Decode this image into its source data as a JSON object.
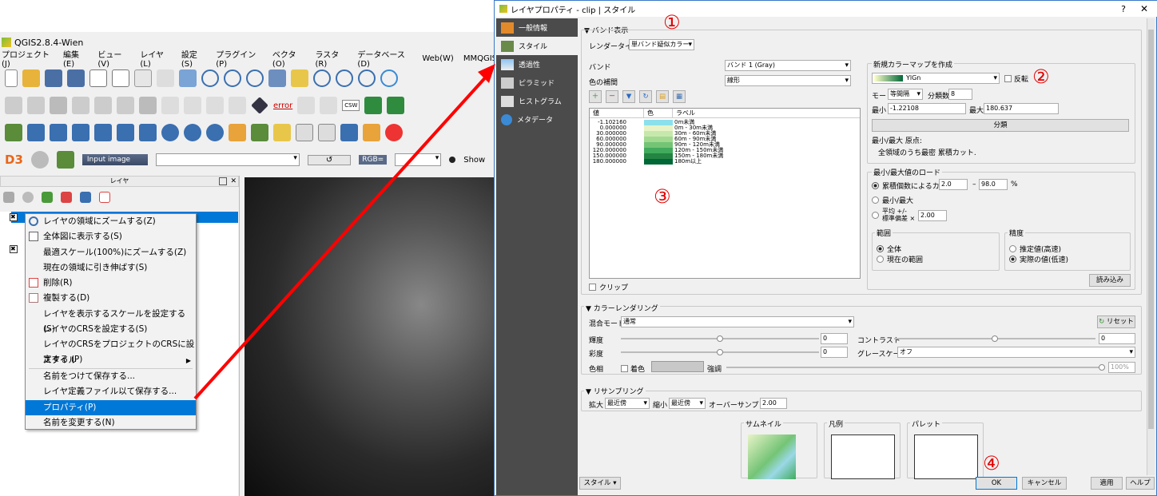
{
  "qgis": {
    "title": "QGIS2.8.4-Wien",
    "menu": [
      "プロジェクト(J)",
      "編集(E)",
      "ビュー(V)",
      "レイヤ(L)",
      "設定(S)",
      "プラグイン(P)",
      "ベクタ(O)",
      "ラスタ(R)",
      "データベース(D)",
      "Web(W)",
      "MMQGIS"
    ],
    "toolbar_error": "error",
    "toolbar_csw": "CSW",
    "input_image": "Input image",
    "reload": "↺",
    "rgb_label": "RGB=",
    "show_label": "Show",
    "layers_title": "レイヤ",
    "context_menu": [
      "レイヤの領域にズームする(Z)",
      "全体図に表示する(S)",
      "最適スケール(100%)にズームする(Z)",
      "現在の領域に引き伸ばす(S)",
      "削除(R)",
      "複製する(D)",
      "レイヤを表示するスケールを設定する(S)",
      "レイヤのCRSを設定する(S)",
      "レイヤのCRSをプロジェクトのCRSに設定する (P)",
      "スタイル",
      "名前をつけて保存する...",
      "レイヤ定義ファイル以て保存する...",
      "プロパティ(P)",
      "名前を変更する(N)"
    ]
  },
  "dialog": {
    "title": "レイヤプロパティ - clip | スタイル",
    "help": "?",
    "close": "✕",
    "sidebar": [
      "一般情報",
      "スタイル",
      "透過性",
      "ピラミッド",
      "ヒストグラム",
      "メタデータ"
    ],
    "band_section": "バンド表示",
    "render_type_label": "レンダータイプ",
    "render_type_value": "単バンド疑似カラー",
    "band_label": "バンド",
    "band_value": "バンド 1 (Gray)",
    "interp_label": "色の補間",
    "interp_value": "線形",
    "table_headers": [
      "値",
      "色",
      "ラベル"
    ],
    "table_rows": [
      {
        "value": "-1.102160",
        "label": "0m未満",
        "color": "#8ce0ec"
      },
      {
        "value": "0.000000",
        "label": "0m - 30m未満",
        "color": "#e7f3c6"
      },
      {
        "value": "30.000000",
        "label": "30m - 60m未満",
        "color": "#c7e8ad"
      },
      {
        "value": "60.000000",
        "label": "60m - 90m未満",
        "color": "#a2d990"
      },
      {
        "value": "90.000000",
        "label": "90m - 120m未満",
        "color": "#74c476"
      },
      {
        "value": "120.000000",
        "label": "120m - 150m未満",
        "color": "#41ab5d"
      },
      {
        "value": "150.000000",
        "label": "150m - 180m未満",
        "color": "#238443"
      },
      {
        "value": "180.000000",
        "label": "180m以上",
        "color": "#006837"
      }
    ],
    "clip_label": "クリップ",
    "new_colormap_title": "新規カラーマップを作成",
    "ramp_name": "YlGn",
    "invert_label": "反転",
    "mode_label": "モード",
    "mode_value": "等間隔",
    "classes_label": "分類数",
    "classes_value": "8",
    "min_label": "最小",
    "min_value": "-1.22108",
    "max_label": "最大",
    "max_value": "180.637",
    "classify_button": "分類",
    "minmax_origin_label": "最小/最大 原点:",
    "minmax_origin_value": "全領域のうち最密 累積カット.",
    "load_group_title": "最小/最大値のロード",
    "cumulative_label": "累積個数によるカット",
    "cum_from": "2.0",
    "cum_to": "98.0",
    "percent": "%",
    "minmax_label": "最小/最大",
    "mean_label": "平均 +/-",
    "stddev_label": "標準偏差 ×",
    "stddev_value": "2.00",
    "extent_title": "範囲",
    "extent_full": "全体",
    "extent_current": "現在の範囲",
    "accuracy_title": "精度",
    "acc_estimate": "推定値(高速)",
    "acc_actual": "実際の値(低速)",
    "load_button": "読み込み",
    "color_render_section": "カラーレンダリング",
    "blend_label": "混合モード",
    "blend_value": "通常",
    "reset_button": "リセット",
    "brightness_label": "輝度",
    "brightness_value": "0",
    "contrast_label": "コントラスト",
    "contrast_value": "0",
    "saturation_label": "彩度",
    "saturation_value": "0",
    "grayscale_label": "グレースケール",
    "grayscale_value": "オフ",
    "hue_label": "色相",
    "colorize_label": "着色",
    "strength_label": "強調",
    "strength_value": "100%",
    "resample_section": "リサンプリング",
    "zoom_in_label": "拡大",
    "zoom_in_value": "最近傍",
    "zoom_out_label": "縮小",
    "zoom_out_value": "最近傍",
    "oversample_label": "オーバーサンプリング",
    "oversample_value": "2.00",
    "thumbnail_label": "サムネイル",
    "legend_label": "凡例",
    "palette_label": "パレット",
    "style_button": "スタイル",
    "ok": "OK",
    "cancel": "キャンセル",
    "apply": "適用",
    "help_button": "ヘルプ"
  },
  "annotations": [
    "①",
    "②",
    "③",
    "④"
  ],
  "colors": {
    "accent": "#0078d7",
    "annotation": "#e30000",
    "arrow": "#ff0000"
  }
}
